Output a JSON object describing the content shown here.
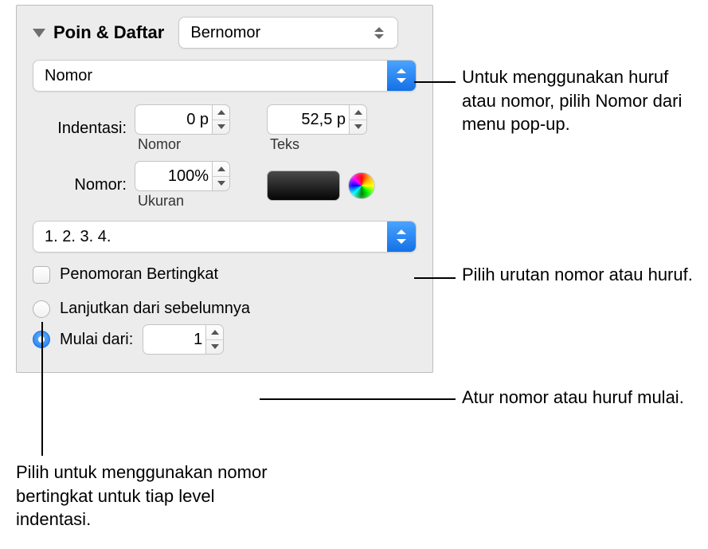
{
  "header": {
    "section_title": "Poin & Daftar",
    "list_type_selected": "Bernomor"
  },
  "number_type_popup": "Nomor",
  "indent": {
    "label": "Indentasi:",
    "number_value": "0 p",
    "number_sublabel": "Nomor",
    "text_value": "52,5 p",
    "text_sublabel": "Teks"
  },
  "number_size": {
    "label": "Nomor:",
    "value": "100%",
    "sublabel": "Ukuran"
  },
  "sequence_popup": "1. 2. 3. 4.",
  "tiered_checkbox_label": "Penomoran Bertingkat",
  "continue_radio_label": "Lanjutkan dari sebelumnya",
  "start_from": {
    "label": "Mulai dari:",
    "value": "1"
  },
  "callouts": {
    "c1": "Untuk menggunakan huruf atau nomor, pilih Nomor dari menu pop-up.",
    "c2": "Pilih urutan nomor atau huruf.",
    "c3": "Atur nomor atau huruf mulai.",
    "c4": "Pilih untuk menggunakan nomor bertingkat untuk tiap level indentasi."
  }
}
